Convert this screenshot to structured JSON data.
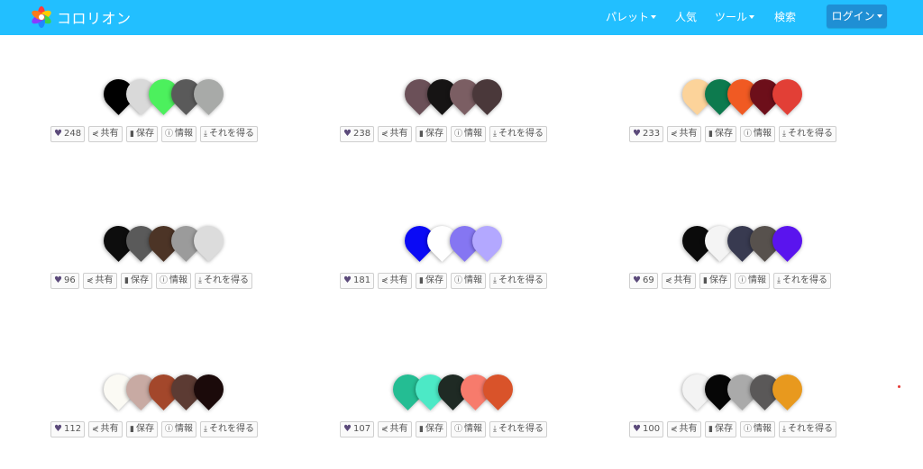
{
  "header": {
    "brand": "コロリオン",
    "nav": [
      {
        "label": "パレット",
        "dropdown": true
      },
      {
        "label": "人気",
        "dropdown": false
      },
      {
        "label": "ツール",
        "dropdown": true
      },
      {
        "label": "検索",
        "dropdown": false
      }
    ],
    "login_label": "ログイン",
    "accent": "#22bfff"
  },
  "labels": {
    "share": "共有",
    "save": "保存",
    "info": "情報",
    "get": "それを得る"
  },
  "palettes": [
    {
      "likes": "248",
      "colors": [
        "#000000",
        "#d9d9d9",
        "#4cf05d",
        "#5a5a5a",
        "#a8aaa8"
      ]
    },
    {
      "likes": "238",
      "colors": [
        "#6b5058",
        "#161414",
        "#7b5e63",
        "#4a383a"
      ]
    },
    {
      "likes": "233",
      "colors": [
        "#fcd39a",
        "#0d7a4e",
        "#f05a23",
        "#6d0f1a",
        "#e23f36"
      ]
    },
    {
      "likes": "96",
      "colors": [
        "#0d0d0d",
        "#5a5a5a",
        "#4c3426",
        "#9b9b9b",
        "#dcdcdc"
      ]
    },
    {
      "likes": "181",
      "colors": [
        "#0a0af5",
        "#ffffff",
        "#8576f2",
        "#b3a8ff"
      ]
    },
    {
      "likes": "69",
      "colors": [
        "#0b0b0b",
        "#f4f4f4",
        "#383a50",
        "#57514d",
        "#5a14ee"
      ]
    },
    {
      "likes": "112",
      "colors": [
        "#fbfaf4",
        "#c8aaa3",
        "#a3472b",
        "#5c3b33",
        "#1b0a0a"
      ]
    },
    {
      "likes": "107",
      "colors": [
        "#24bd93",
        "#4ce9c6",
        "#1f2a24",
        "#f77b6c",
        "#d9532a"
      ]
    },
    {
      "likes": "100",
      "colors": [
        "#f3f3f3",
        "#060606",
        "#aaaaaa",
        "#5a5858",
        "#e8991e"
      ]
    }
  ]
}
